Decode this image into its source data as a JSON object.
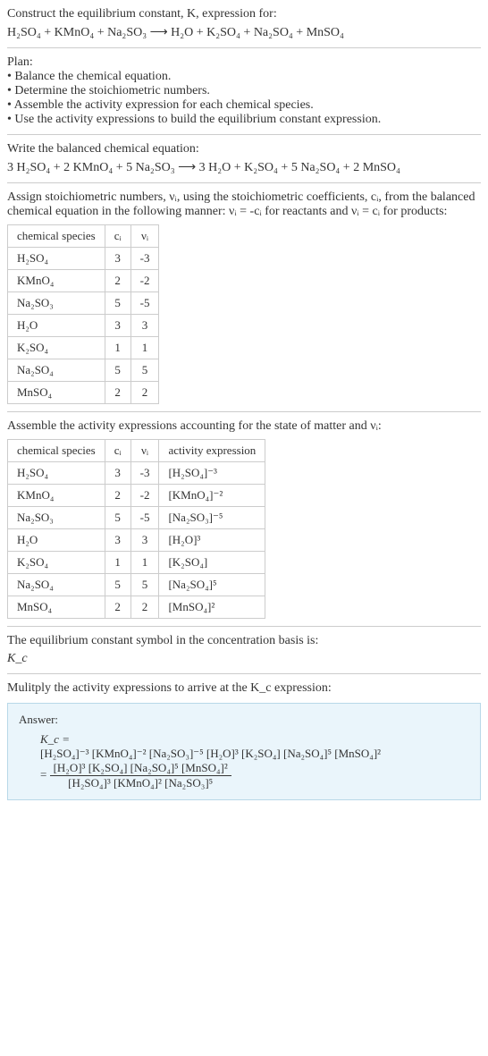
{
  "intro": {
    "line1": "Construct the equilibrium constant, K, expression for:",
    "equation": "H₂SO₄ + KMnO₄ + Na₂SO₃ ⟶ H₂O + K₂SO₄ + Na₂SO₄ + MnSO₄"
  },
  "plan": {
    "heading": "Plan:",
    "b1": "• Balance the chemical equation.",
    "b2": "• Determine the stoichiometric numbers.",
    "b3": "• Assemble the activity expression for each chemical species.",
    "b4": "• Use the activity expressions to build the equilibrium constant expression."
  },
  "balanced": {
    "heading": "Write the balanced chemical equation:",
    "equation": "3 H₂SO₄ + 2 KMnO₄ + 5 Na₂SO₃ ⟶ 3 H₂O + K₂SO₄ + 5 Na₂SO₄ + 2 MnSO₄"
  },
  "stoich": {
    "heading": "Assign stoichiometric numbers, νᵢ, using the stoichiometric coefficients, cᵢ, from the balanced chemical equation in the following manner: νᵢ = -cᵢ for reactants and νᵢ = cᵢ for products:",
    "headers": {
      "species": "chemical species",
      "ci": "cᵢ",
      "vi": "νᵢ"
    },
    "rows": [
      {
        "species": "H₂SO₄",
        "ci": "3",
        "vi": "-3"
      },
      {
        "species": "KMnO₄",
        "ci": "2",
        "vi": "-2"
      },
      {
        "species": "Na₂SO₃",
        "ci": "5",
        "vi": "-5"
      },
      {
        "species": "H₂O",
        "ci": "3",
        "vi": "3"
      },
      {
        "species": "K₂SO₄",
        "ci": "1",
        "vi": "1"
      },
      {
        "species": "Na₂SO₄",
        "ci": "5",
        "vi": "5"
      },
      {
        "species": "MnSO₄",
        "ci": "2",
        "vi": "2"
      }
    ]
  },
  "activity": {
    "heading": "Assemble the activity expressions accounting for the state of matter and νᵢ:",
    "headers": {
      "species": "chemical species",
      "ci": "cᵢ",
      "vi": "νᵢ",
      "expr": "activity expression"
    },
    "rows": [
      {
        "species": "H₂SO₄",
        "ci": "3",
        "vi": "-3",
        "expr": "[H₂SO₄]⁻³"
      },
      {
        "species": "KMnO₄",
        "ci": "2",
        "vi": "-2",
        "expr": "[KMnO₄]⁻²"
      },
      {
        "species": "Na₂SO₃",
        "ci": "5",
        "vi": "-5",
        "expr": "[Na₂SO₃]⁻⁵"
      },
      {
        "species": "H₂O",
        "ci": "3",
        "vi": "3",
        "expr": "[H₂O]³"
      },
      {
        "species": "K₂SO₄",
        "ci": "1",
        "vi": "1",
        "expr": "[K₂SO₄]"
      },
      {
        "species": "Na₂SO₄",
        "ci": "5",
        "vi": "5",
        "expr": "[Na₂SO₄]⁵"
      },
      {
        "species": "MnSO₄",
        "ci": "2",
        "vi": "2",
        "expr": "[MnSO₄]²"
      }
    ]
  },
  "kc_symbol": {
    "heading": "The equilibrium constant symbol in the concentration basis is:",
    "symbol": "K_c"
  },
  "multiply": {
    "heading": "Mulitply the activity expressions to arrive at the K_c expression:"
  },
  "answer": {
    "label": "Answer:",
    "line1": "K_c =",
    "line2": "[H₂SO₄]⁻³ [KMnO₄]⁻² [Na₂SO₃]⁻⁵ [H₂O]³ [K₂SO₄] [Na₂SO₄]⁵ [MnSO₄]²",
    "eq": "= ",
    "num": "[H₂O]³ [K₂SO₄] [Na₂SO₄]⁵ [MnSO₄]²",
    "den": "[H₂SO₄]³ [KMnO₄]² [Na₂SO₃]⁵"
  }
}
